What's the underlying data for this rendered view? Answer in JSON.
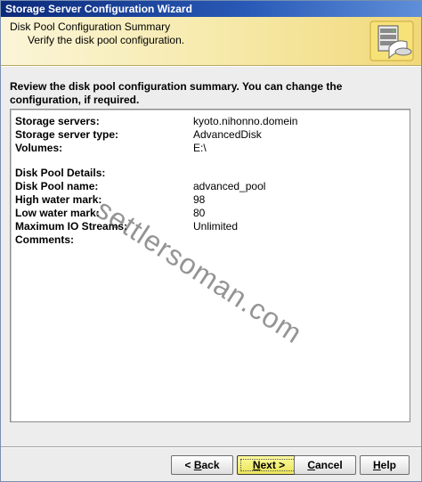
{
  "window": {
    "title": "Storage Server Configuration Wizard"
  },
  "header": {
    "title": "Disk Pool Configuration Summary",
    "subtitle": "Verify the disk pool configuration."
  },
  "instructions": "Review the disk pool configuration summary. You can change the configuration, if required.",
  "summary": {
    "storage_servers": {
      "label": "Storage servers:",
      "value": "kyoto.nihonno.domein"
    },
    "storage_server_type": {
      "label": "Storage server type:",
      "value": "AdvancedDisk"
    },
    "volumes": {
      "label": "Volumes:",
      "value": "E:\\"
    },
    "details_heading": "Disk Pool Details:",
    "disk_pool_name": {
      "label": "Disk Pool name:",
      "value": "advanced_pool"
    },
    "high_water_mark": {
      "label": "High water mark:",
      "value": "98"
    },
    "low_water_mark": {
      "label": "Low water mark:",
      "value": "80"
    },
    "max_io_streams": {
      "label": "Maximum IO Streams:",
      "value": "Unlimited"
    },
    "comments": {
      "label": "Comments:",
      "value": ""
    }
  },
  "watermark": "settlersoman.com",
  "buttons": {
    "back": {
      "mnemonic": "B",
      "rest": "ack",
      "prefix": "< "
    },
    "next": {
      "mnemonic": "N",
      "rest": "ext",
      "suffix": " >"
    },
    "cancel": {
      "mnemonic": "C",
      "rest": "ancel"
    },
    "help": {
      "mnemonic": "H",
      "rest": "elp"
    }
  },
  "colors": {
    "title_bar": "#0c2a7a",
    "header_band": "#f6e9a8",
    "next_button": "#e9e35a"
  },
  "icons": {
    "header": "server-disk-wizard-icon"
  }
}
